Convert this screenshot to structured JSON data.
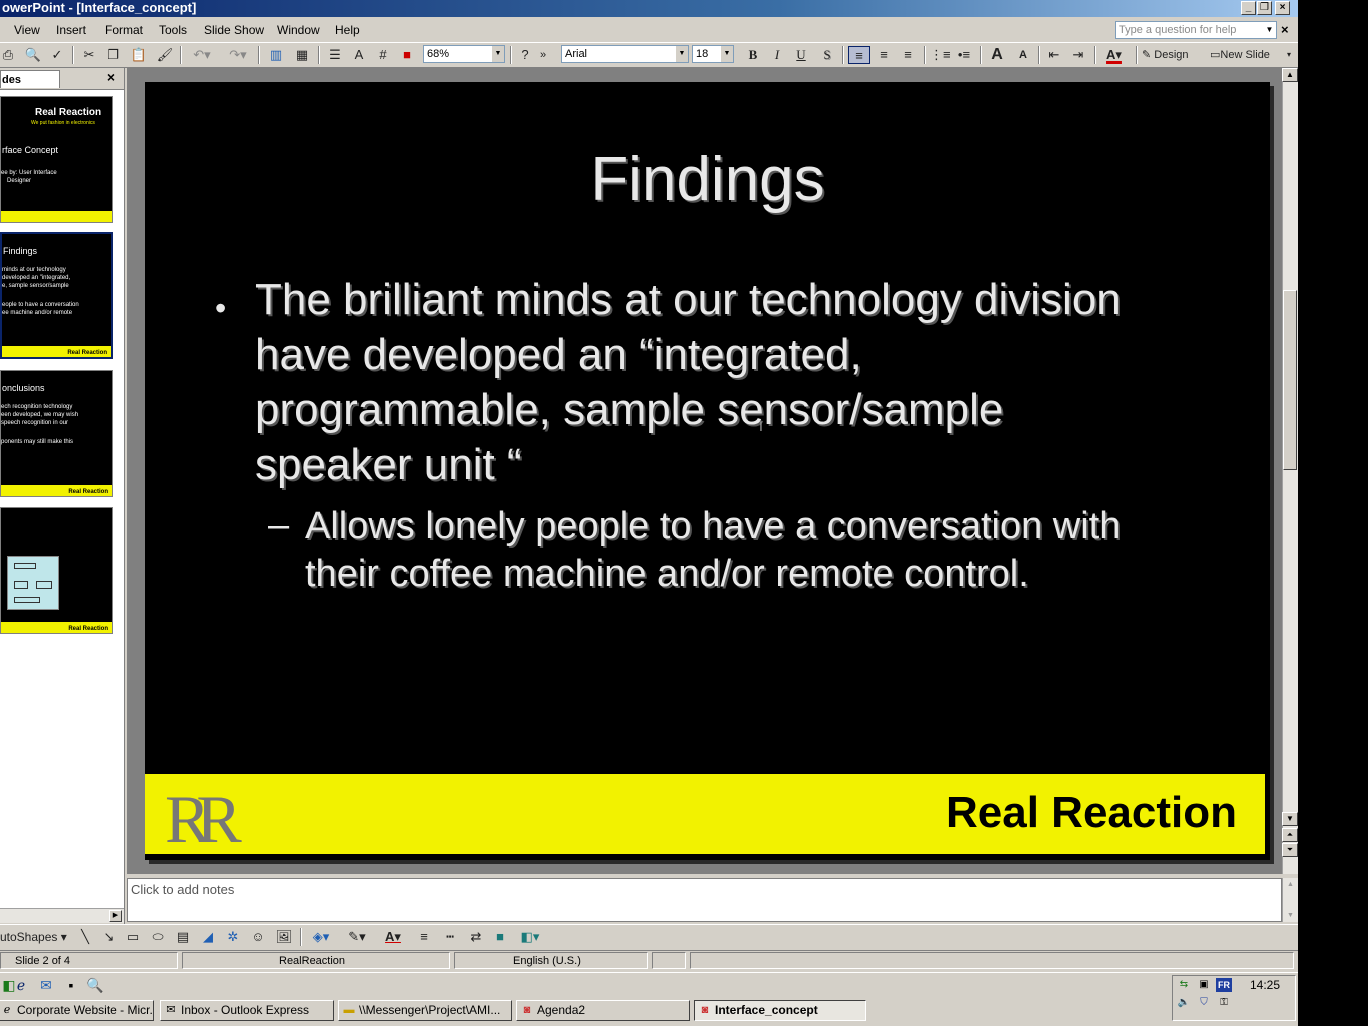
{
  "window": {
    "title": "owerPoint - [Interface_concept]"
  },
  "menu": [
    "View",
    "Insert",
    "Format",
    "Tools",
    "Slide Show",
    "Window",
    "Help"
  ],
  "help_box": {
    "placeholder": "Type a question for help"
  },
  "toolbar": {
    "zoom": "68%",
    "font": "Arial",
    "font_size": "18",
    "bold": "B",
    "italic": "I",
    "underline": "U",
    "shadow": "S",
    "design_label": "Design",
    "new_slide_label": "New Slide"
  },
  "slides_pane": {
    "tab_label": "des",
    "thumbnails": [
      {
        "title": "Real Reaction",
        "subtitle": "We put fashion in electronics",
        "lines": [
          "rface Concept",
          "ee by: User Interface",
          "Designer"
        ]
      },
      {
        "title": "Findings",
        "lines": [
          "minds at our technology",
          "developed an \"integrated,",
          "e, sample sensor/sample",
          "",
          "eople to have a conversation",
          "ee machine and/or remote"
        ],
        "brand": "Real Reaction"
      },
      {
        "title": "onclusions",
        "lines": [
          "ech recognition technology",
          "een developed, we may wish",
          "speech recognition in our",
          "",
          "ponents may still make this"
        ],
        "brand": "Real Reaction"
      },
      {
        "title": "",
        "lines": [],
        "brand": "Real Reaction"
      }
    ]
  },
  "slide": {
    "title": "Findings",
    "bullet": "The brilliant minds at our technology division have developed an “integrated, programmable, sample sensor/sample speaker unit “",
    "sub_bullet": "Allows lonely people to have a conversation with their coffee machine and/or remote control.",
    "footer_logo": "RR",
    "footer_brand": "Real Reaction",
    "colors": {
      "background": "#000000",
      "footer": "#f2f200",
      "text": "#e8e8e8"
    }
  },
  "notes": {
    "placeholder": "Click to add notes"
  },
  "drawing_toolbar": {
    "autoshapes_label": "utoShapes"
  },
  "status": {
    "slide_index": "Slide 2 of 4",
    "design": "RealReaction",
    "language": "English (U.S.)"
  },
  "taskbar": {
    "tasks": [
      "Corporate Website - Micr...",
      "Inbox - Outlook Express",
      "\\\\Messenger\\Project\\AMI...",
      "Agenda2",
      "Interface_concept"
    ],
    "tray_lang": "FR",
    "clock": "14:25"
  }
}
